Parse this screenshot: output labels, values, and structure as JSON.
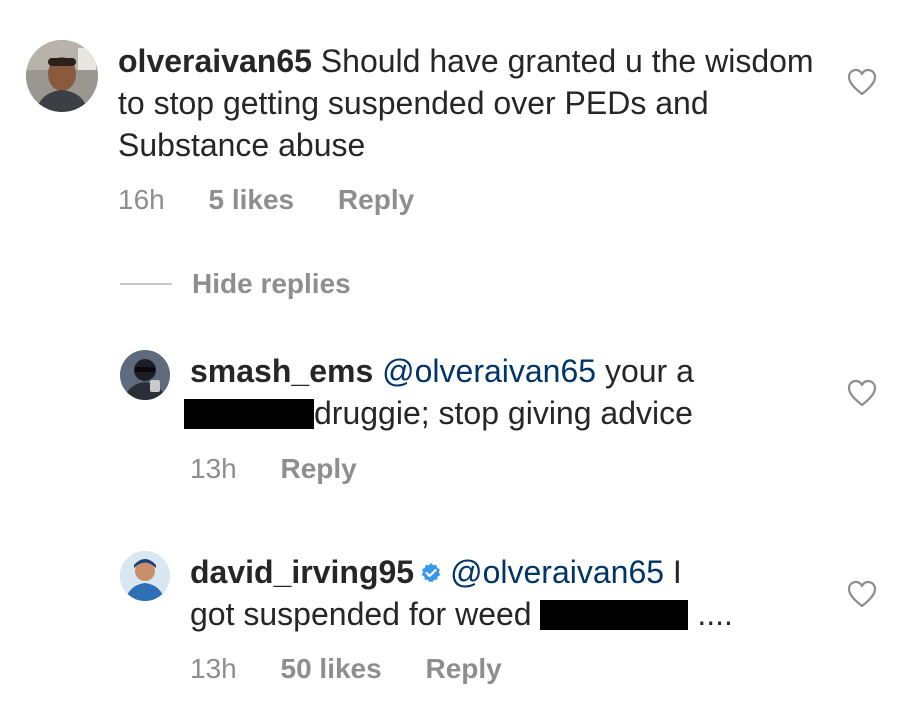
{
  "comments": [
    {
      "username": "olveraivan65",
      "text": "Should have granted u the wisdom to stop getting suspended over PEDs and Substance abuse",
      "time": "16h",
      "likes": "5 likes",
      "reply_label": "Reply",
      "avatar_icon": "user-avatar"
    }
  ],
  "hide_replies_label": "Hide replies",
  "replies": [
    {
      "username": "smash_ems",
      "mention": "@olveraivan65",
      "text_before_redaction": "your a",
      "text_after_redaction": "druggie; stop giving advice",
      "time": "13h",
      "reply_label": "Reply"
    },
    {
      "username": "david_irving95",
      "verified": true,
      "mention": "@olveraivan65",
      "text_line1_tail": "I",
      "text_before_redaction": "got suspended for weed",
      "text_after_redaction": "....",
      "time": "13h",
      "likes": "50 likes",
      "reply_label": "Reply"
    }
  ],
  "colors": {
    "text": "#262626",
    "mention": "#003569",
    "meta": "#8e8e8e",
    "verified": "#3897f0",
    "redaction": "#000000"
  },
  "icons": [
    "heart-icon",
    "verified-badge-icon",
    "user-avatar"
  ]
}
